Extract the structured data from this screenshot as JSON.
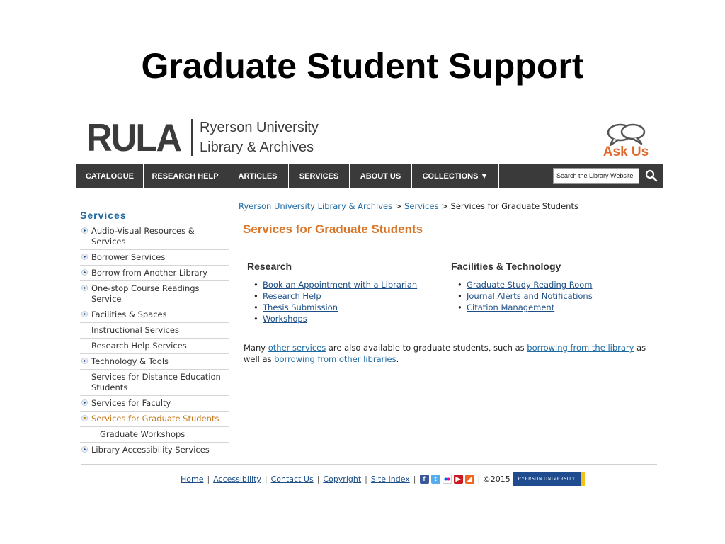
{
  "slide": {
    "title": "Graduate Student Support"
  },
  "header": {
    "logo_text": "RULA",
    "logo_name_line1": "Ryerson University",
    "logo_name_line2": "Library & Archives",
    "askus_label": "Ask Us",
    "accent_color": "#e06a2e"
  },
  "nav": {
    "items": [
      "CATALOGUE",
      "RESEARCH HELP",
      "ARTICLES",
      "SERVICES",
      "ABOUT US",
      "COLLECTIONS ▼"
    ],
    "search_placeholder": "Search the Library Website",
    "search_icon": "search-icon"
  },
  "sidebar": {
    "title": "Services",
    "items": [
      {
        "label": "Audio-Visual Resources & Services",
        "arrow": "right"
      },
      {
        "label": "Borrower Services",
        "arrow": "right"
      },
      {
        "label": "Borrow from Another Library",
        "arrow": "right"
      },
      {
        "label": "One-stop Course Readings Service",
        "arrow": "right"
      },
      {
        "label": "Facilities & Spaces",
        "arrow": "right"
      },
      {
        "label": "Instructional Services",
        "arrow": "none"
      },
      {
        "label": "Research Help Services",
        "arrow": "none"
      },
      {
        "label": "Technology & Tools",
        "arrow": "right"
      },
      {
        "label": "Services for Distance Education Students",
        "arrow": "none"
      },
      {
        "label": "Services for Faculty",
        "arrow": "right"
      },
      {
        "label": "Services for Graduate Students",
        "arrow": "down"
      },
      {
        "label": "Graduate Workshops",
        "arrow": "none"
      },
      {
        "label": "Library Accessibility Services",
        "arrow": "right"
      }
    ]
  },
  "breadcrumb": {
    "home": "Ryerson University Library & Archives",
    "sep": ">",
    "services": "Services",
    "current": "Services for Graduate Students"
  },
  "main": {
    "heading": "Services for Graduate Students",
    "research": {
      "title": "Research",
      "links": [
        "Book an Appointment with a Librarian",
        "Research Help",
        "Thesis Submission",
        "Workshops"
      ]
    },
    "facilities": {
      "title": "Facilities & Technology",
      "links": [
        "Graduate Study Reading Room",
        "Journal Alerts and Notifications",
        "Citation Management"
      ]
    },
    "paragraph": {
      "t1": "Many ",
      "link1": "other services",
      "t2": " are also available to graduate students, such as ",
      "link2": "borrowing from the library",
      "t3": " as well as ",
      "link3": "borrowing from other libraries",
      "t4": "."
    }
  },
  "footer": {
    "links": [
      "Home",
      "Accessibility",
      "Contact Us",
      "Copyright",
      "Site Index"
    ],
    "copyright": "| ©2015",
    "badge": "RYERSON UNIVERSITY",
    "social_icons": [
      "facebook-icon",
      "twitter-icon",
      "flickr-icon",
      "youtube-icon",
      "rss-icon"
    ]
  }
}
